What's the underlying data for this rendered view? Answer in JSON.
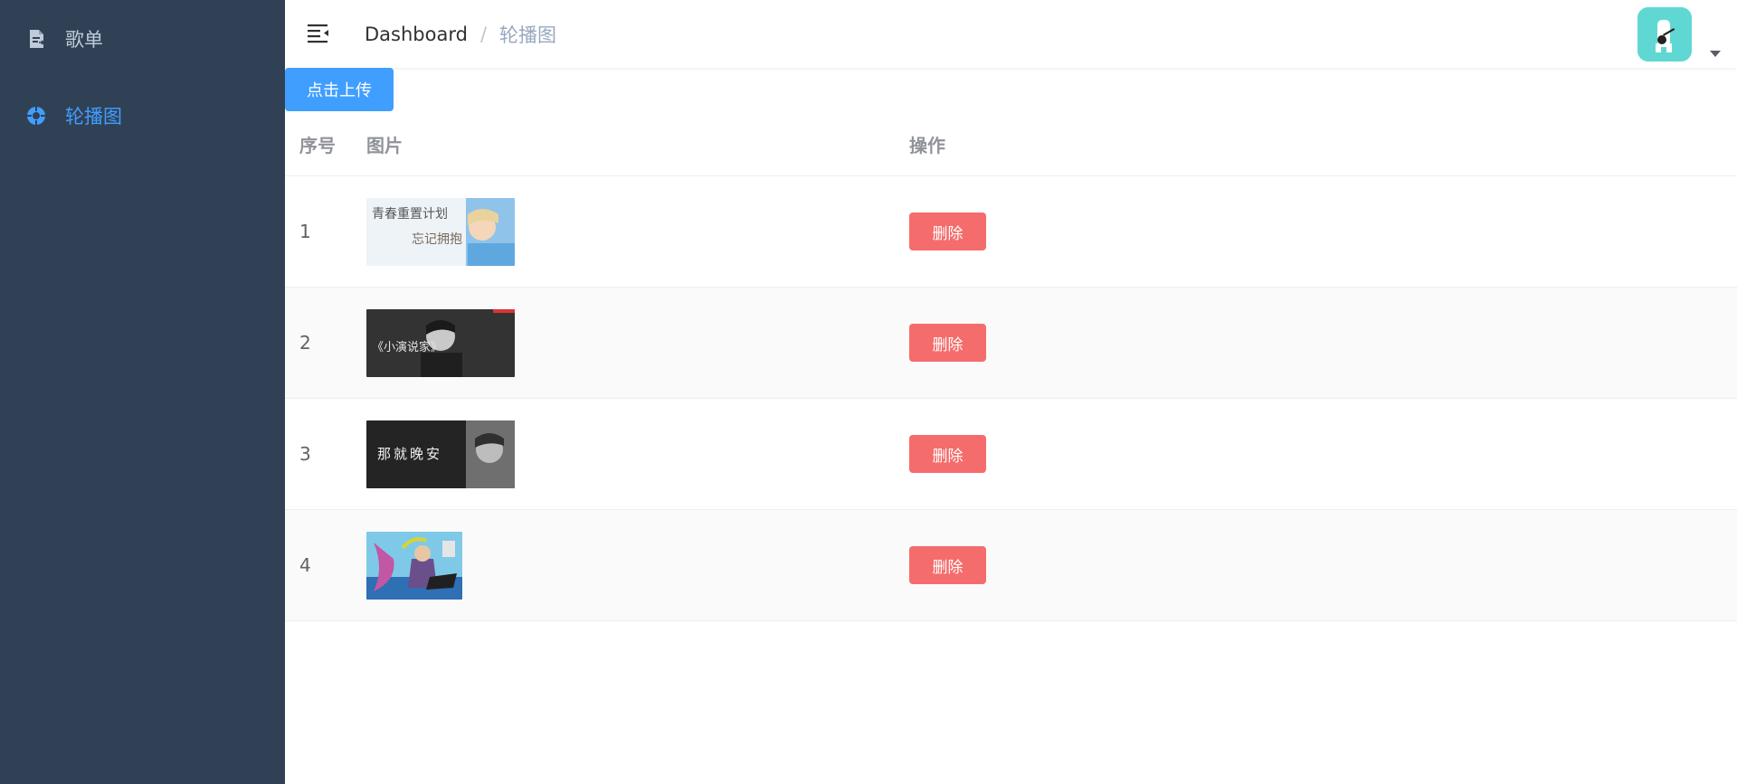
{
  "sidebar": {
    "items": [
      {
        "label": "歌单",
        "icon": "document-icon"
      },
      {
        "label": "轮播图",
        "icon": "gear-icon",
        "active": true
      }
    ],
    "active_color": "#409eff"
  },
  "navbar": {
    "breadcrumb_home": "Dashboard",
    "breadcrumb_sep": "/",
    "breadcrumb_current": "轮播图"
  },
  "upload_label": "点击上传",
  "table": {
    "headers": {
      "index": "序号",
      "image": "图片",
      "action": "操作"
    },
    "rows": [
      {
        "index": "1",
        "action_label": "删除",
        "thumb_text_left": "青春重置计划",
        "thumb_text_right": "忘记拥抱"
      },
      {
        "index": "2",
        "action_label": "删除",
        "thumb_text": "《小演说家》"
      },
      {
        "index": "3",
        "action_label": "删除",
        "thumb_text": "那就晚安"
      },
      {
        "index": "4",
        "action_label": "删除"
      }
    ]
  },
  "colors": {
    "sidebar_bg": "#304156",
    "primary": "#409eff",
    "danger": "#f56c6c",
    "avatar_bg": "#5fd8d4"
  }
}
